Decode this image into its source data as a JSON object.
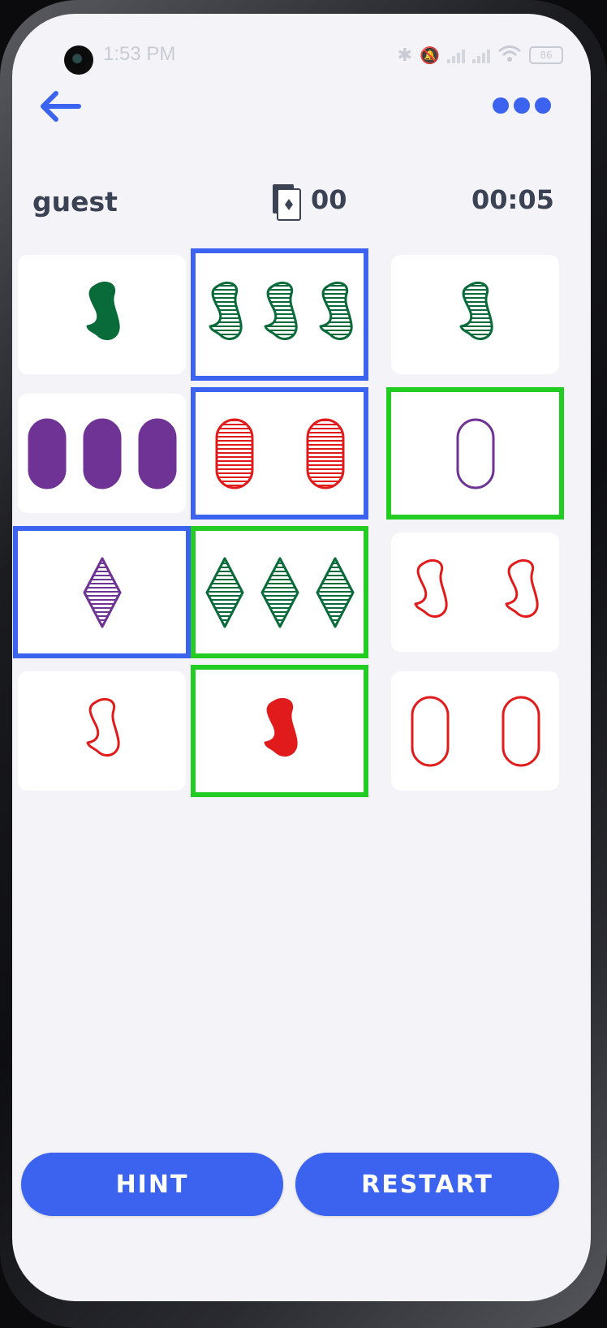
{
  "status_bar": {
    "time": "1:53 PM",
    "battery": "86"
  },
  "header": {
    "back_icon": "arrow-left-icon",
    "menu_icon": "more-dots-icon"
  },
  "game": {
    "player": "guest",
    "deck_count": "00",
    "timer": "00:05",
    "cards": [
      {
        "count": 1,
        "shape": "squiggle",
        "color": "green",
        "fill": "solid"
      },
      {
        "count": 3,
        "shape": "squiggle",
        "color": "green",
        "fill": "striped",
        "selected": "blue"
      },
      {
        "count": 1,
        "shape": "squiggle",
        "color": "green",
        "fill": "striped"
      },
      {
        "count": 3,
        "shape": "oval",
        "color": "purple",
        "fill": "solid"
      },
      {
        "count": 2,
        "shape": "oval",
        "color": "red",
        "fill": "striped",
        "selected": "blue"
      },
      {
        "count": 1,
        "shape": "oval",
        "color": "purple",
        "fill": "outline",
        "selected": "green"
      },
      {
        "count": 1,
        "shape": "diamond",
        "color": "purple",
        "fill": "striped",
        "selected": "blue"
      },
      {
        "count": 3,
        "shape": "diamond",
        "color": "green",
        "fill": "striped",
        "selected": "green"
      },
      {
        "count": 2,
        "shape": "squiggle",
        "color": "red",
        "fill": "outline"
      },
      {
        "count": 1,
        "shape": "squiggle",
        "color": "red",
        "fill": "outline"
      },
      {
        "count": 1,
        "shape": "squiggle",
        "color": "red",
        "fill": "solid",
        "selected": "green"
      },
      {
        "count": 2,
        "shape": "oval",
        "color": "red",
        "fill": "outline"
      }
    ]
  },
  "colors": {
    "green": "#0a6b3a",
    "red": "#e11b1b",
    "purple": "#6e3394",
    "accent": "#3b63f0",
    "select_green": "#22cc22"
  },
  "buttons": {
    "hint": "HINT",
    "restart": "RESTART"
  }
}
